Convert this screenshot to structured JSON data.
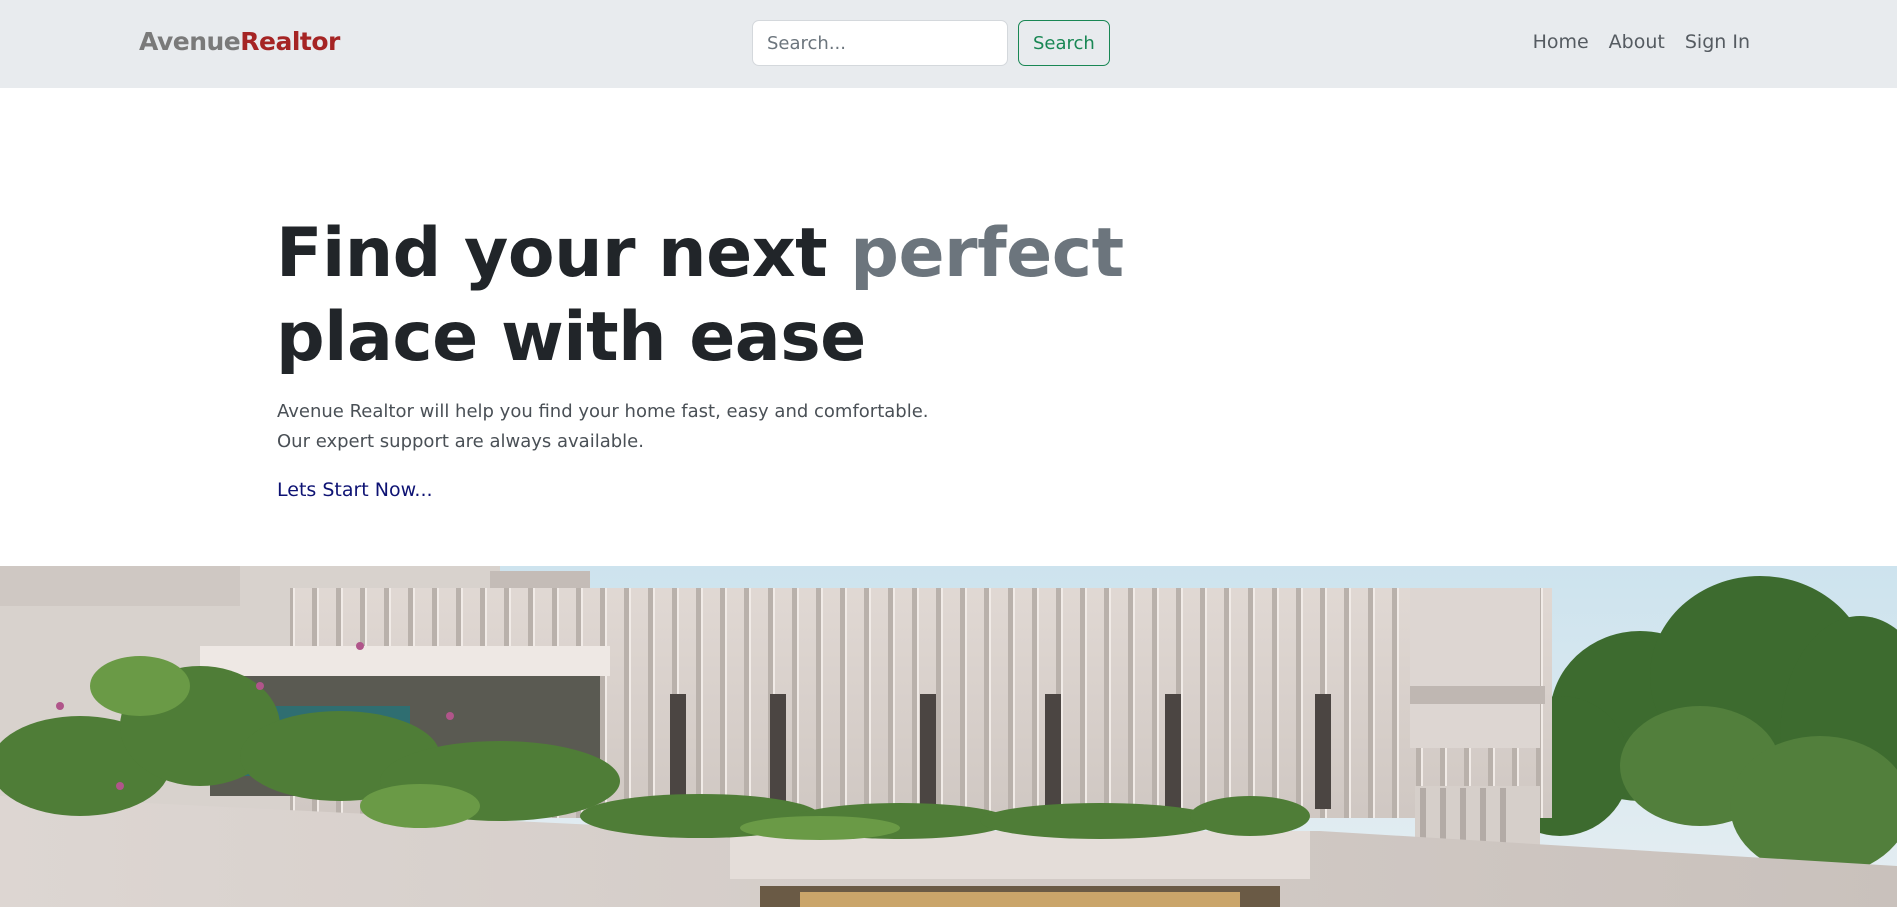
{
  "navbar": {
    "brand_part1": "Avenue",
    "brand_part2": "Realtor",
    "search_placeholder": "Search...",
    "search_button": "Search",
    "links": [
      "Home",
      "About",
      "Sign In"
    ]
  },
  "hero": {
    "title_part1": "Find your next ",
    "title_accent": "perfect",
    "title_part2": "place with ease",
    "description_line1": "Avenue Realtor will help you find your home fast, easy and comfortable.",
    "description_line2": "Our expert support are always available.",
    "cta_link": "Lets Start Now..."
  },
  "colors": {
    "navbar_bg": "#e8ebee",
    "brand_primary": "#7a7a7a",
    "brand_accent": "#a52424",
    "search_button": "#198754",
    "title_accent": "#6c757d",
    "cta_link": "#0d1273"
  }
}
